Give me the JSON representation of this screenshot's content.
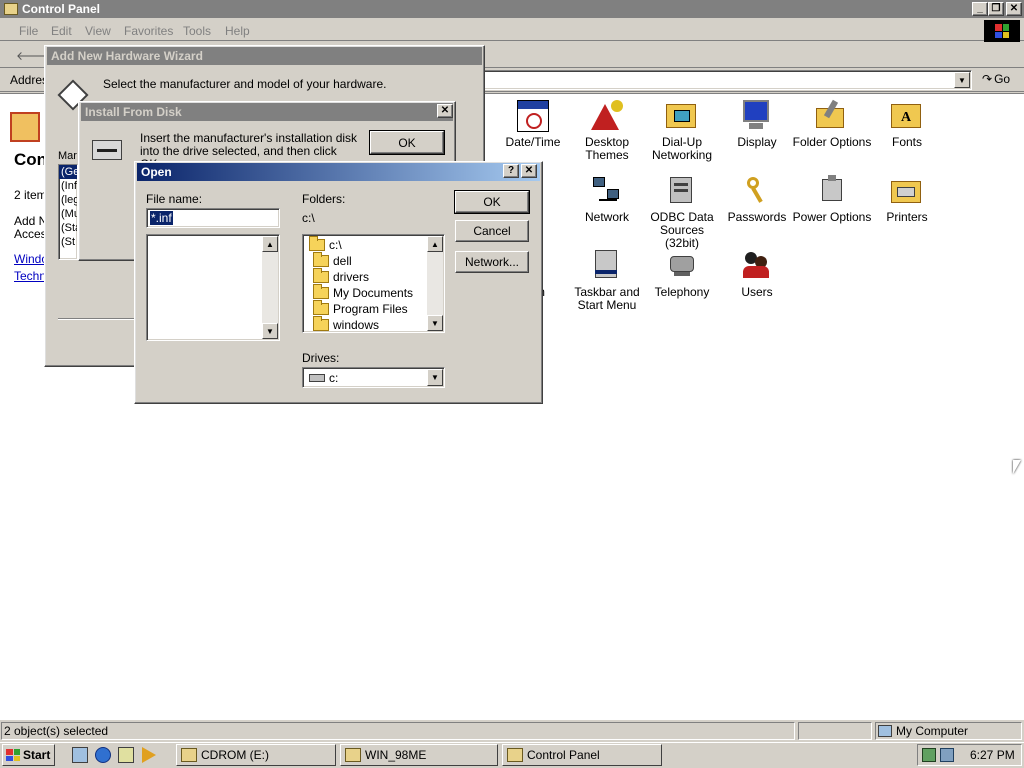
{
  "main_window": {
    "title": "Control Panel",
    "menu": [
      "File",
      "Edit",
      "View",
      "Favorites",
      "Tools",
      "Help"
    ],
    "back_label": "B",
    "address_label": "Addres",
    "go_label": "Go",
    "left_pane": {
      "title_fragment": "Con",
      "count_fragment": "2 items",
      "desc_fragment_1": "Add N",
      "desc_fragment_2": "Access",
      "link_1": "Windo",
      "link_2": "Techni"
    },
    "icons": [
      {
        "label": "Date/Time",
        "icon": "calendar-clock-icon"
      },
      {
        "label": "Desktop Themes",
        "icon": "themes-icon"
      },
      {
        "label": "Dial-Up Networking",
        "icon": "dialup-icon"
      },
      {
        "label": "Display",
        "icon": "display-icon"
      },
      {
        "label": "Folder Options",
        "icon": "folder-options-icon"
      },
      {
        "label": "Fonts",
        "icon": "fonts-icon"
      },
      {
        "label": "e",
        "icon": "partial-icon"
      },
      {
        "label": "Network",
        "icon": "network-icon"
      },
      {
        "label": "ODBC Data Sources (32bit)",
        "icon": "odbc-icon"
      },
      {
        "label": "Passwords",
        "icon": "keys-icon"
      },
      {
        "label": "Power Options",
        "icon": "power-icon"
      },
      {
        "label": "Printers",
        "icon": "printer-icon"
      },
      {
        "label": "m",
        "icon": "partial-icon"
      },
      {
        "label": "Taskbar and Start Menu",
        "icon": "taskbar-icon"
      },
      {
        "label": "Telephony",
        "icon": "telephone-icon"
      },
      {
        "label": "Users",
        "icon": "users-icon"
      }
    ],
    "status_left": "2 object(s) selected",
    "status_right": "My Computer"
  },
  "wizard": {
    "title": "Add New Hardware Wizard",
    "instruction": "Select the manufacturer and model of your hardware.",
    "list_label_fragment": "Mar",
    "list_items": [
      "(Ge",
      "(Inf",
      "(leg",
      "(Mu",
      "(Sta",
      "(St"
    ]
  },
  "install_from_disk": {
    "title": "Install From Disk",
    "message": "Insert the manufacturer's installation disk into the drive selected, and then click OK.",
    "ok_label": "OK"
  },
  "open_dialog": {
    "title": "Open",
    "help_glyph": "?",
    "close_glyph": "✕",
    "file_name_label": "File name:",
    "file_name_value": "*.inf",
    "folders_label": "Folders:",
    "current_folder": "c:\\",
    "folders": [
      "c:\\",
      "dell",
      "drivers",
      "My Documents",
      "Program Files",
      "windows"
    ],
    "drives_label": "Drives:",
    "drive_value": "c:",
    "ok_label": "OK",
    "cancel_label": "Cancel",
    "network_label": "Network..."
  },
  "taskbar": {
    "start_label": "Start",
    "tasks": [
      "CDROM (E:)",
      "WIN_98ME",
      "Control Panel"
    ],
    "clock": "6:27 PM"
  }
}
